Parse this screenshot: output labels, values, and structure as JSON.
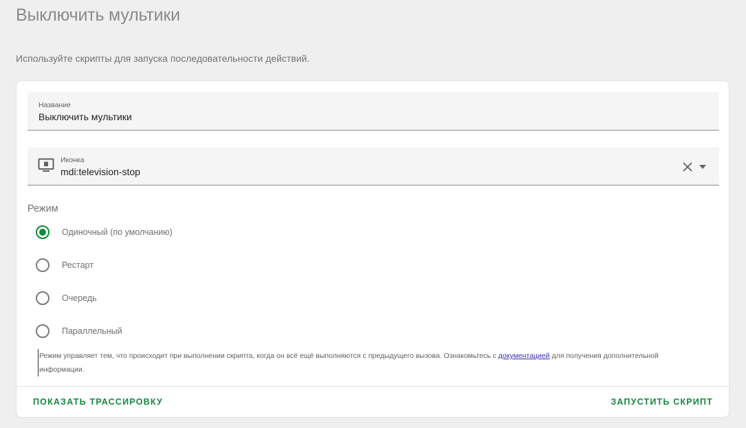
{
  "page": {
    "title": "Выключить мультики",
    "description": "Используйте скрипты для запуска последовательности действий."
  },
  "name_field": {
    "label": "Название",
    "value": "Выключить мультики"
  },
  "icon_field": {
    "label": "Иконка",
    "value": "mdi:television-stop",
    "icon": "television-stop-icon",
    "clear_icon": "close-icon",
    "dropdown_icon": "caret-down-icon"
  },
  "mode": {
    "label": "Режим",
    "options": [
      {
        "label": "Одиночный (по умолчанию)",
        "selected": true
      },
      {
        "label": "Рестарт",
        "selected": false
      },
      {
        "label": "Очередь",
        "selected": false
      },
      {
        "label": "Параллельный",
        "selected": false
      }
    ],
    "helper_before": "Режим управляет тем, что происходит при выполнении скрипта, когда он всё ещё выполняются с предыдущего вызова. Ознакомьтесь с ",
    "helper_link": "документацией",
    "helper_after": " для получения дополнительной информации."
  },
  "actions": {
    "trace_label": "ПОКАЗАТЬ ТРАССИРОВКУ",
    "run_label": "ЗАПУСТИТЬ СКРИПТ"
  },
  "colors": {
    "accent": "#0f8a3a",
    "background": "#efefef",
    "card": "#ffffff",
    "link": "#3a2db5"
  }
}
